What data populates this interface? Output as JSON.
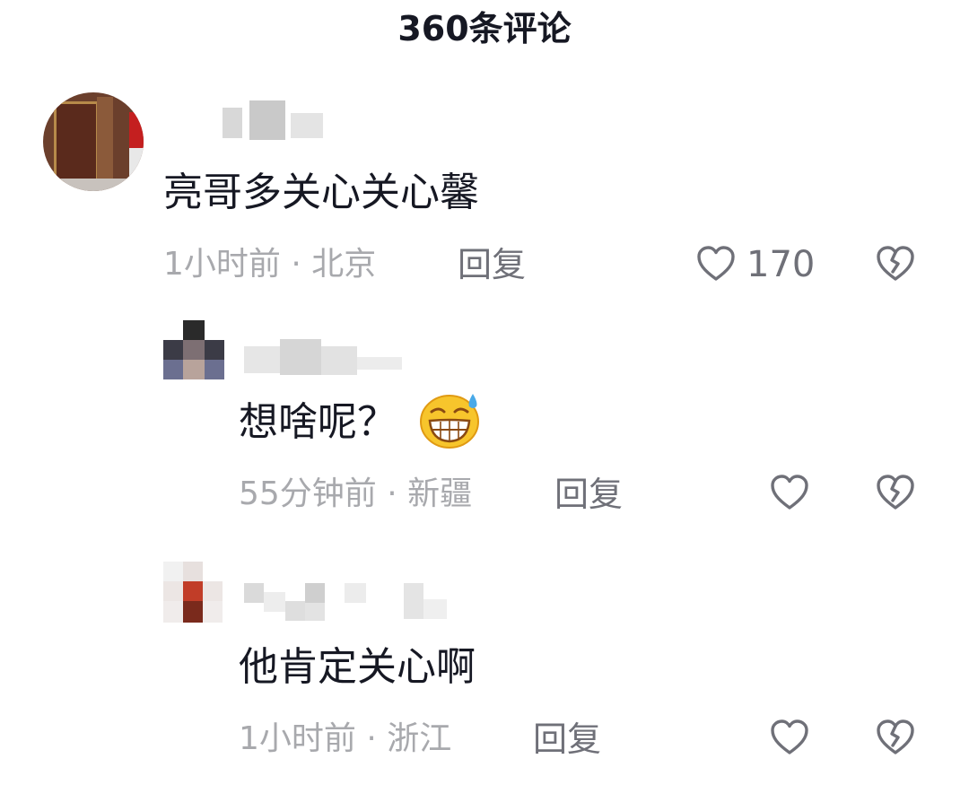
{
  "header": {
    "title": "360条评论"
  },
  "comments": [
    {
      "text": "亮哥多关心关心馨",
      "time": "1小时前",
      "sep": "·",
      "location": "北京",
      "reply_label": "回复",
      "likes": "170"
    },
    {
      "text": "想啥呢？",
      "emoji": "grinning-sweat-emoji",
      "time": "55分钟前",
      "sep": "·",
      "location": "新疆",
      "reply_label": "回复",
      "likes": ""
    },
    {
      "text": "他肯定关心啊",
      "time": "1小时前",
      "sep": "·",
      "location": "浙江",
      "reply_label": "回复",
      "likes": ""
    }
  ],
  "colors": {
    "text": "#161823",
    "meta": "#a8a9ad",
    "icon": "#6f7078"
  },
  "icons": [
    "heart-outline-icon",
    "broken-heart-icon"
  ]
}
